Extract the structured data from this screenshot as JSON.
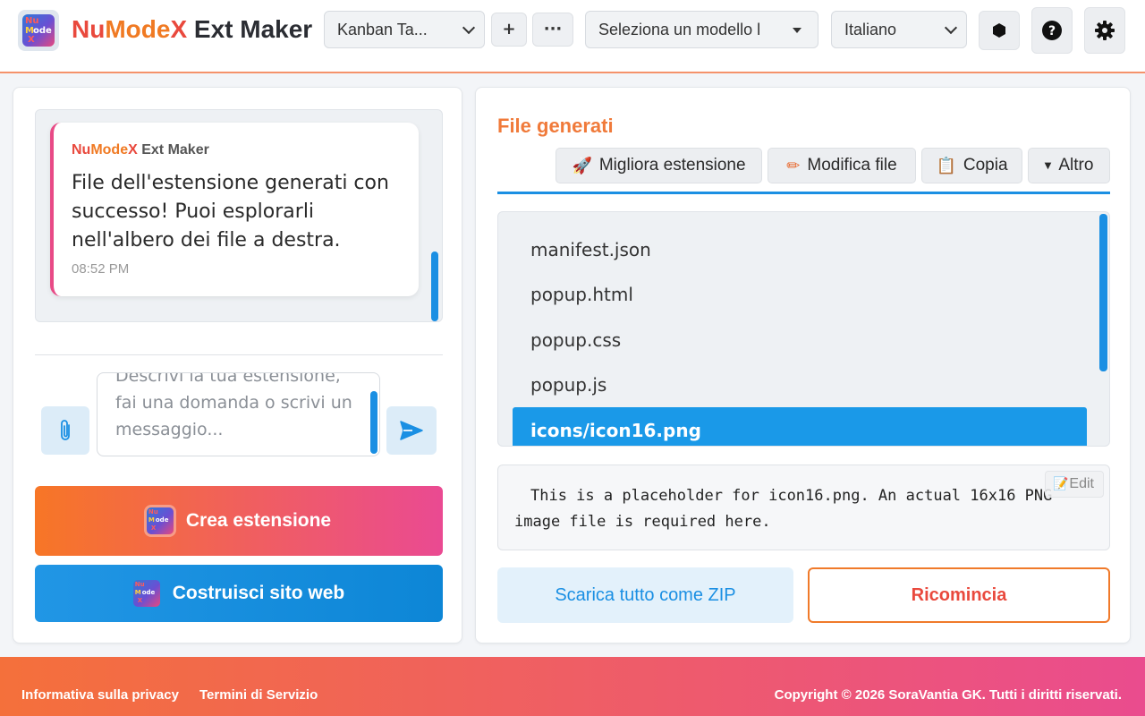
{
  "header": {
    "app_title_parts": [
      "Nu",
      "Mode",
      "X",
      " Ext Maker"
    ],
    "logo_letters": [
      "Nu",
      "M",
      "ode",
      "X"
    ],
    "project_select": "Kanban Ta...",
    "add_label": "+",
    "more_label": "···",
    "model_select": "Seleziona un modello l",
    "language_select": "Italiano",
    "icons": [
      "circle-icon",
      "help-icon",
      "gear-icon"
    ]
  },
  "chat": {
    "sender_parts": [
      "Nu",
      "Mode",
      "X",
      " Ext Maker"
    ],
    "message": "File dell'estensione generati con successo! Puoi esplorarli nell'albero dei file a destra.",
    "time": "08:52 PM",
    "input_placeholder": "Descrivi la tua estensione, fai una domanda o scrivi un messaggio..."
  },
  "actions": {
    "create_label": "Crea estensione",
    "site_label": "Costruisci sito web"
  },
  "files": {
    "title": "File generati",
    "toolbar": {
      "improve": "Migliora estensione",
      "edit": "Modifica file",
      "copy": "Copia",
      "more": "Altro"
    },
    "tree": [
      "manifest.json",
      "popup.html",
      "popup.css",
      "popup.js"
    ],
    "selected": "icons/icon16.png",
    "content": "This is a placeholder for icon16.png. An actual 16x16 PNG image file is required here.",
    "edit_label": "Edit",
    "zip_label": "Scarica tutto come ZIP",
    "restart_label": "Ricomincia"
  },
  "footer": {
    "privacy": "Informativa sulla privacy",
    "terms": "Termini di Servizio",
    "copyright": "Copyright © 2026 SoraVantia GK. Tutti i diritti riservati."
  },
  "colors": {
    "accent_blue": "#1a8fe3",
    "accent_orange": "#f07a2a",
    "accent_pink": "#ea4a92",
    "brand_red": "#e9493d"
  }
}
